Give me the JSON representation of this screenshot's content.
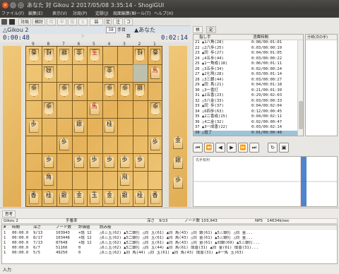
{
  "window": {
    "title": "あなた 対 Gikou 2 2017/05/08 3:35:14 - ShogiGUI"
  },
  "menu": [
    "ファイル(F)",
    "編集(E)",
    "表示(V)",
    "対局(P)",
    "定跡(J)",
    "局面編集(B)",
    "ツール(T)",
    "ヘルプ(H)"
  ],
  "toolbar": [
    "対局",
    "検討",
    "待て",
    "中断",
    "投了",
    "ヒント",
    "詰",
    "定跡",
    "注",
    "コア数"
  ],
  "players": {
    "gote": "△Gikou 2",
    "sente": "▲あなた",
    "gote_time": "0:00:48",
    "sente_time": "0:02:14",
    "move_no": "38",
    "move_suffix": "手目"
  },
  "columns": [
    "9",
    "8",
    "7",
    "6",
    "5",
    "4",
    "3",
    "2",
    "1"
  ],
  "rows": [
    "一",
    "二",
    "三",
    "四",
    "五",
    "六",
    "七",
    "八",
    "九"
  ],
  "pieces": [
    {
      "c": 0,
      "r": 0,
      "t": "香",
      "g": true
    },
    {
      "c": 1,
      "r": 0,
      "t": "桂",
      "g": true
    },
    {
      "c": 2,
      "r": 0,
      "t": "銀",
      "g": true
    },
    {
      "c": 3,
      "r": 0,
      "t": "金",
      "g": true
    },
    {
      "c": 4,
      "r": 0,
      "t": "玉",
      "g": true,
      "promo": true
    },
    {
      "c": 7,
      "r": 0,
      "t": "桂",
      "g": true
    },
    {
      "c": 8,
      "r": 0,
      "t": "香",
      "g": true
    },
    {
      "c": 1,
      "r": 1,
      "t": "飛",
      "g": true
    },
    {
      "c": 5,
      "r": 1,
      "t": "金",
      "g": true
    },
    {
      "c": 8,
      "r": 1,
      "t": "馬",
      "promo": true
    },
    {
      "c": 0,
      "r": 2,
      "t": "歩",
      "g": true
    },
    {
      "c": 2,
      "r": 2,
      "t": "歩",
      "g": true
    },
    {
      "c": 3,
      "r": 2,
      "t": "歩",
      "g": true
    },
    {
      "c": 5,
      "r": 2,
      "t": "歩",
      "g": true
    },
    {
      "c": 6,
      "r": 2,
      "t": "歩",
      "g": true
    },
    {
      "c": 7,
      "r": 2,
      "t": "銀",
      "g": true
    },
    {
      "c": 1,
      "r": 3,
      "t": "歩",
      "g": true
    },
    {
      "c": 4,
      "r": 3,
      "t": "馬",
      "promo": true
    },
    {
      "c": 8,
      "r": 3,
      "t": "歩",
      "g": true
    },
    {
      "c": 0,
      "r": 4,
      "t": "歩"
    },
    {
      "c": 3,
      "r": 4,
      "t": "銀"
    },
    {
      "c": 5,
      "r": 4,
      "t": "桂"
    },
    {
      "c": 2,
      "r": 5,
      "t": "歩"
    },
    {
      "c": 8,
      "r": 5,
      "t": "歩"
    },
    {
      "c": 1,
      "r": 6,
      "t": "歩"
    },
    {
      "c": 3,
      "r": 6,
      "t": "歩"
    },
    {
      "c": 4,
      "r": 6,
      "t": "歩"
    },
    {
      "c": 5,
      "r": 6,
      "t": "歩"
    },
    {
      "c": 6,
      "r": 6,
      "t": "歩"
    },
    {
      "c": 7,
      "r": 6,
      "t": "歩"
    },
    {
      "c": 1,
      "r": 7,
      "t": "角"
    },
    {
      "c": 6,
      "r": 7,
      "t": "飛"
    },
    {
      "c": 0,
      "r": 8,
      "t": "香"
    },
    {
      "c": 1,
      "r": 8,
      "t": "桂"
    },
    {
      "c": 2,
      "r": 8,
      "t": "銀"
    },
    {
      "c": 3,
      "r": 8,
      "t": "金"
    },
    {
      "c": 4,
      "r": 8,
      "t": "玉"
    },
    {
      "c": 5,
      "r": 8,
      "t": "金"
    },
    {
      "c": 6,
      "r": 8,
      "t": "銀"
    },
    {
      "c": 7,
      "r": 8,
      "t": "桂"
    },
    {
      "c": 8,
      "r": 8,
      "t": "香"
    }
  ],
  "hand": [
    {
      "t": "金"
    },
    {
      "t": "銀"
    },
    {
      "t": "歩"
    }
  ],
  "tabs": {
    "kifu": "棋譜",
    "joseki": "定跡"
  },
  "kifu_headers": {
    "move": "指し手",
    "time": "消費時間",
    "branch": "分岐(次の手)"
  },
  "kifu": [
    [
      "21 ▲1八角(28)",
      "0:08/00:01:01"
    ],
    [
      "22 △2六歩(25)",
      "0:03/00:00:19"
    ],
    [
      "23 ▲同 歩(27)",
      "0:04/00:01:05"
    ],
    [
      "24 △4五歩(44)",
      "0:03/00:00:22"
    ],
    [
      "25 ▲1一角成(18)",
      "0:06/00:01:11"
    ],
    [
      "26 △3五歩(34)",
      "0:02/00:00:24"
    ],
    [
      "27 ▲2七飛(28)",
      "0:03/00:01:14"
    ],
    [
      "28 △3三銀(44)",
      "0:03/00:00:27"
    ],
    [
      "29 ▲同 馬(21)",
      "0:04/00:01:18"
    ],
    [
      "30 △3一香打",
      "0:21/00:01:30"
    ],
    [
      "31 ▲2五香(23)",
      "0:29/00:02:03"
    ],
    [
      "32 △5八金(33)",
      "0:03/00:00:33"
    ],
    [
      "33 ▲同 歩(37)",
      "0:04/00:02:04"
    ],
    [
      "34 △6四歩(63)",
      "0:12/00:00:45"
    ],
    [
      "35 ▲2二香成(25)",
      "0:04/00:02:11"
    ],
    [
      "36 △4二金(32)",
      "0:02/00:00:47"
    ],
    [
      "37 ▲3一成香(22)",
      "0:03/00:02:14"
    ],
    [
      "38 △投了",
      "0:01/00:00:48"
    ]
  ],
  "graph": {
    "label": "先手有利"
  },
  "engine": {
    "tab": "思考",
    "name": "Gikou 2",
    "hand_label": "手番率",
    "depth_label": "深さ",
    "depth": "9/13",
    "nodes_label": "ノード数",
    "nodes": "103,943",
    "nps_label": "NPS",
    "nps": "14634k/sec"
  },
  "engine_cols": [
    "#",
    "時間",
    "深さ",
    "ノード数",
    "評価値",
    "読み筋"
  ],
  "engine_rows": [
    [
      "1",
      "00:00.0",
      "9/13",
      "103943",
      "+詰 12",
      "△6三玉(62) ▲5二銀打 △同 玉(61) ▲同 馬(43) △同 銀(61) ▲5三銀打 △同 金..."
    ],
    [
      "1",
      "00:00.0",
      "8/17",
      "103448",
      "+詰 12",
      "△6三玉(62) ▲5二銀打 △同 玉(61) ▲同 馬(43) △同 金(61) ▲5三銀打 △同 金..."
    ],
    [
      "1",
      "00:00.0",
      "7/13",
      "87648",
      "+詰 12",
      "△6三玉(62) ▲5二銀打 △同 玉(61) ▲同 馬(43) △同 金(61) ▲同銀(69) ▲5三銀打..."
    ],
    [
      "1",
      "00:00.0",
      "6/7",
      "51166",
      "0",
      "△6三玉(62) ▲5二銀打 △同 玉(44) ▲同 馬(61) 成香(31) ▲同 金(61) 成香(31)..."
    ],
    [
      "1",
      "00:00.0",
      "5/5",
      "49250",
      "0",
      "△6三玉(62) ▲同 馬(44) △同 玉(61) ▲同 馬(43) 成香(31) ▲4一馬 玉(63)"
    ]
  ],
  "input": {
    "label": "入力"
  }
}
